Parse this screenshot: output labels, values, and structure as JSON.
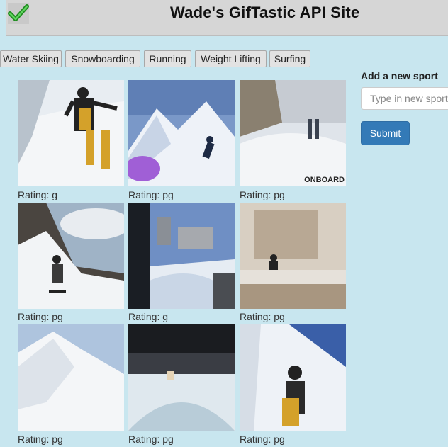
{
  "header": {
    "title": "Wade's GifTastic API Site",
    "logo_icon": "green-checkmark-icon"
  },
  "sport_buttons": [
    "Water Skiing",
    "Snowboarding",
    "Running",
    "Weight Lifting",
    "Surfing"
  ],
  "form": {
    "label": "Add a new sport",
    "placeholder": "Type in new sport",
    "submit_label": "Submit"
  },
  "gifs": [
    {
      "rating": "Rating: g"
    },
    {
      "rating": "Rating: pg"
    },
    {
      "rating": "Rating: pg",
      "watermark": "ONBOARD"
    },
    {
      "rating": "Rating: pg"
    },
    {
      "rating": "Rating: g"
    },
    {
      "rating": "Rating: pg"
    },
    {
      "rating": "Rating: pg"
    },
    {
      "rating": "Rating: pg"
    },
    {
      "rating": "Rating: pg"
    }
  ],
  "colors": {
    "background": "#c8e6ef",
    "header": "#d6d6d6",
    "submit": "#337ab7"
  }
}
